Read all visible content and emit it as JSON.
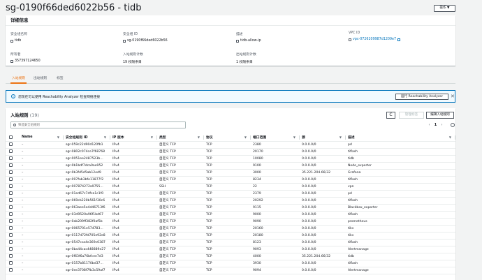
{
  "page": {
    "title": "sg-0190f66ded6022b56 - tidb",
    "actions_label": "操作 ▼"
  },
  "details": {
    "header": "详细信息",
    "fields": [
      {
        "label": "安全组名称",
        "value": "tidb"
      },
      {
        "label": "安全组 ID",
        "value": "sg-0190f66ded6022b56"
      },
      {
        "label": "描述",
        "value": "tidb-allow-ip"
      },
      {
        "label": "VPC ID",
        "value": "vpc-0726209987d1209e7"
      },
      {
        "label": "所有者",
        "value": "357397124650"
      },
      {
        "label": "入站规则计数",
        "value": "19 权限条目"
      },
      {
        "label": "出站规则计数",
        "value": "1 权限条目"
      }
    ]
  },
  "tabs": [
    "入站规则",
    "出站规则",
    "标签"
  ],
  "alert": {
    "message": "您现在可以使用 Reachability Analyzer 检查网络连接",
    "button": "运行 Reachability Analyzer",
    "close": "✕"
  },
  "rules": {
    "title": "入站规则",
    "count": "(19)",
    "refresh": "C",
    "manage_label": "管理标签",
    "edit_label": "编辑入站规则",
    "search_placeholder": "筛选安全组规则",
    "page": "1",
    "prev": "‹",
    "next": "›",
    "sort_glyph": "▼",
    "columns": [
      "Name",
      "安全组规则 ID",
      "IP 版本",
      "类型",
      "协议",
      "端口范围",
      "源",
      "描述"
    ],
    "rows": [
      [
        "–",
        "sgr-059c22d90d120fb1",
        "IPv4",
        "自定义 TCP",
        "TCP",
        "2380",
        "0.0.0.0/0",
        "pd"
      ],
      [
        "–",
        "sgr-0802c074ce7f68768",
        "IPv4",
        "自定义 TCP",
        "TCP",
        "20170",
        "0.0.0.0/0",
        "tiflash"
      ],
      [
        "–",
        "sgr-0051ee2487523b...",
        "IPv4",
        "自定义 TCP",
        "TCP",
        "10080",
        "0.0.0.0/0",
        "tidb"
      ],
      [
        "–",
        "sgr-0b1bdf7dca0ae952",
        "IPv4",
        "自定义 TCP",
        "TCP",
        "9100",
        "0.0.0.0/0",
        "Node_exporter"
      ],
      [
        "–",
        "sgr-0b3fd5d5ab12ed9",
        "IPv4",
        "自定义 TCP",
        "TCP",
        "3000",
        "35.221.204.66/32",
        "Grafana"
      ],
      [
        "–",
        "sgr-097fab3bfe11877f2",
        "IPv4",
        "自定义 TCP",
        "TCP",
        "8234",
        "0.0.0.0/0",
        "tiflash"
      ],
      [
        "–",
        "sgr-007874272a9755...",
        "IPv4",
        "SSH",
        "TCP",
        "22",
        "0.0.0.0/0",
        "vpn"
      ],
      [
        "–",
        "sgr-01ed67c7dfca1c1f0",
        "IPv4",
        "自定义 TCP",
        "TCP",
        "2379",
        "0.0.0.0/0",
        "pd"
      ],
      [
        "–",
        "sgr-069cb220b561f30c6",
        "IPv4",
        "自定义 TCP",
        "TCP",
        "20292",
        "0.0.0.0/0",
        "tiflash"
      ],
      [
        "–",
        "sgr-063aee5e4d46713f6",
        "IPv4",
        "自定义 TCP",
        "TCP",
        "9115",
        "0.0.0.0/0",
        "Blackbox_exporter"
      ],
      [
        "–",
        "sgr-03d9520a96f1bd67",
        "IPv4",
        "自定义 TCP",
        "TCP",
        "9000",
        "0.0.0.0/0",
        "tiflash"
      ],
      [
        "–",
        "sgr-0ab209ff382f0af5b",
        "IPv4",
        "自定义 TCP",
        "TCP",
        "9090",
        "0.0.0.0/0",
        "prometheus"
      ],
      [
        "–",
        "sgr-0065701e574783...",
        "IPv4",
        "自定义 TCP",
        "TCP",
        "20160",
        "0.0.0.0/0",
        "tikv"
      ],
      [
        "–",
        "sgr-0117d72fd705e92e8",
        "IPv4",
        "自定义 TCP",
        "TCP",
        "20180",
        "0.0.0.0/0",
        "tikv"
      ],
      [
        "–",
        "sgr-0547cca4e369c0387",
        "IPv4",
        "自定义 TCP",
        "TCP",
        "8123",
        "0.0.0.0/0",
        "tiflash"
      ],
      [
        "–",
        "sgr-0ba44cac448889e27",
        "IPv4",
        "自定义 TCP",
        "TCP",
        "9093",
        "0.0.0.0/0",
        "Alertmanage"
      ],
      [
        "–",
        "sgr-0f63f6a76bfcee7d3",
        "IPv4",
        "自定义 TCP",
        "TCP",
        "4000",
        "35.221.204.66/32",
        "tidb"
      ],
      [
        "–",
        "sgr-0157b81170bd37...",
        "IPv4",
        "自定义 TCP",
        "TCP",
        "3930",
        "0.0.0.0/0",
        "tiflash"
      ],
      [
        "–",
        "sgr-0ee3708f7fb3c59af7",
        "IPv4",
        "自定义 TCP",
        "TCP",
        "9094",
        "0.0.0.0/0",
        "Alertmanage"
      ]
    ]
  },
  "colors": {
    "accent": "#ec7211",
    "link": "#0073bb",
    "info_bg": "#f1faff"
  }
}
